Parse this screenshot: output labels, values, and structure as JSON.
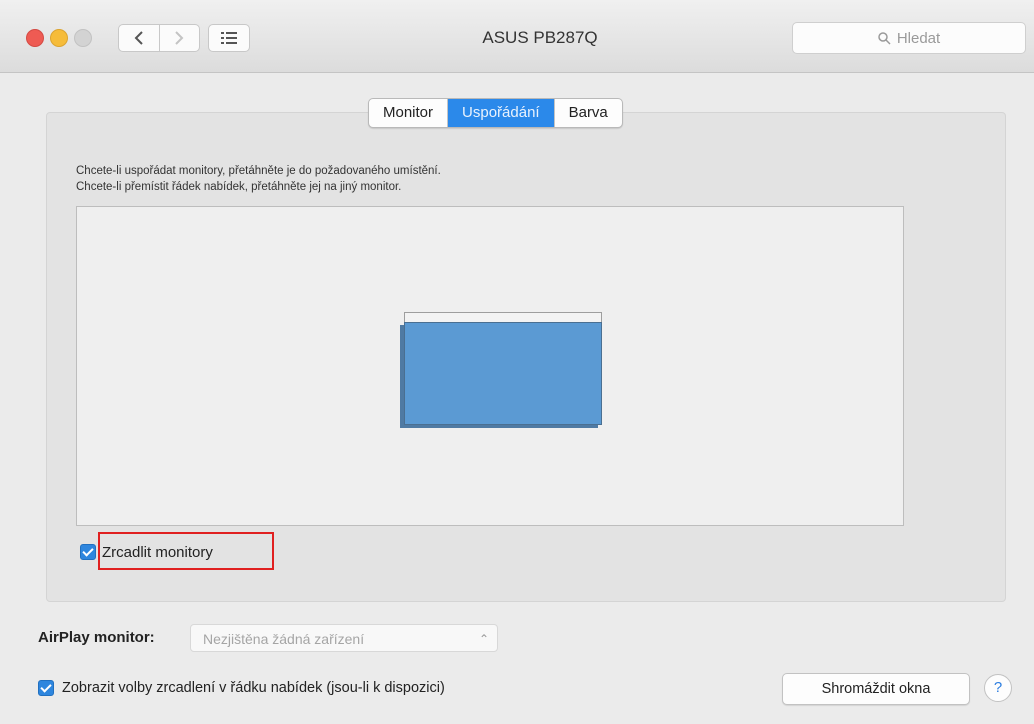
{
  "window": {
    "title": "ASUS PB287Q"
  },
  "toolbar": {
    "back_icon": "chevron-left-icon",
    "forward_icon": "chevron-right-icon",
    "show_all_icon": "grid-icon",
    "search_placeholder": "Hledat"
  },
  "tabs": [
    {
      "label": "Monitor",
      "active": false
    },
    {
      "label": "Uspořádání",
      "active": true
    },
    {
      "label": "Barva",
      "active": false
    }
  ],
  "arrangement": {
    "instruction_line1": "Chcete-li uspořádat monitory, přetáhněte je do požadovaného umístění.",
    "instruction_line2": "Chcete-li přemístit řádek nabídek, přetáhněte jej na jiný monitor.",
    "mirror_label": "Zrcadlit monitory",
    "mirror_checked": true
  },
  "airplay": {
    "label": "AirPlay monitor:",
    "value": "Nezjištěna žádná zařízení"
  },
  "menu_option": {
    "label": "Zobrazit volby zrcadlení v řádku nabídek (jsou-li k dispozici)",
    "checked": true
  },
  "buttons": {
    "gather": "Shromáždit okna",
    "help": "?"
  },
  "colors": {
    "accent": "#2b89ea",
    "highlight": "#e02020",
    "monitor_fill": "#5b9ad3"
  }
}
